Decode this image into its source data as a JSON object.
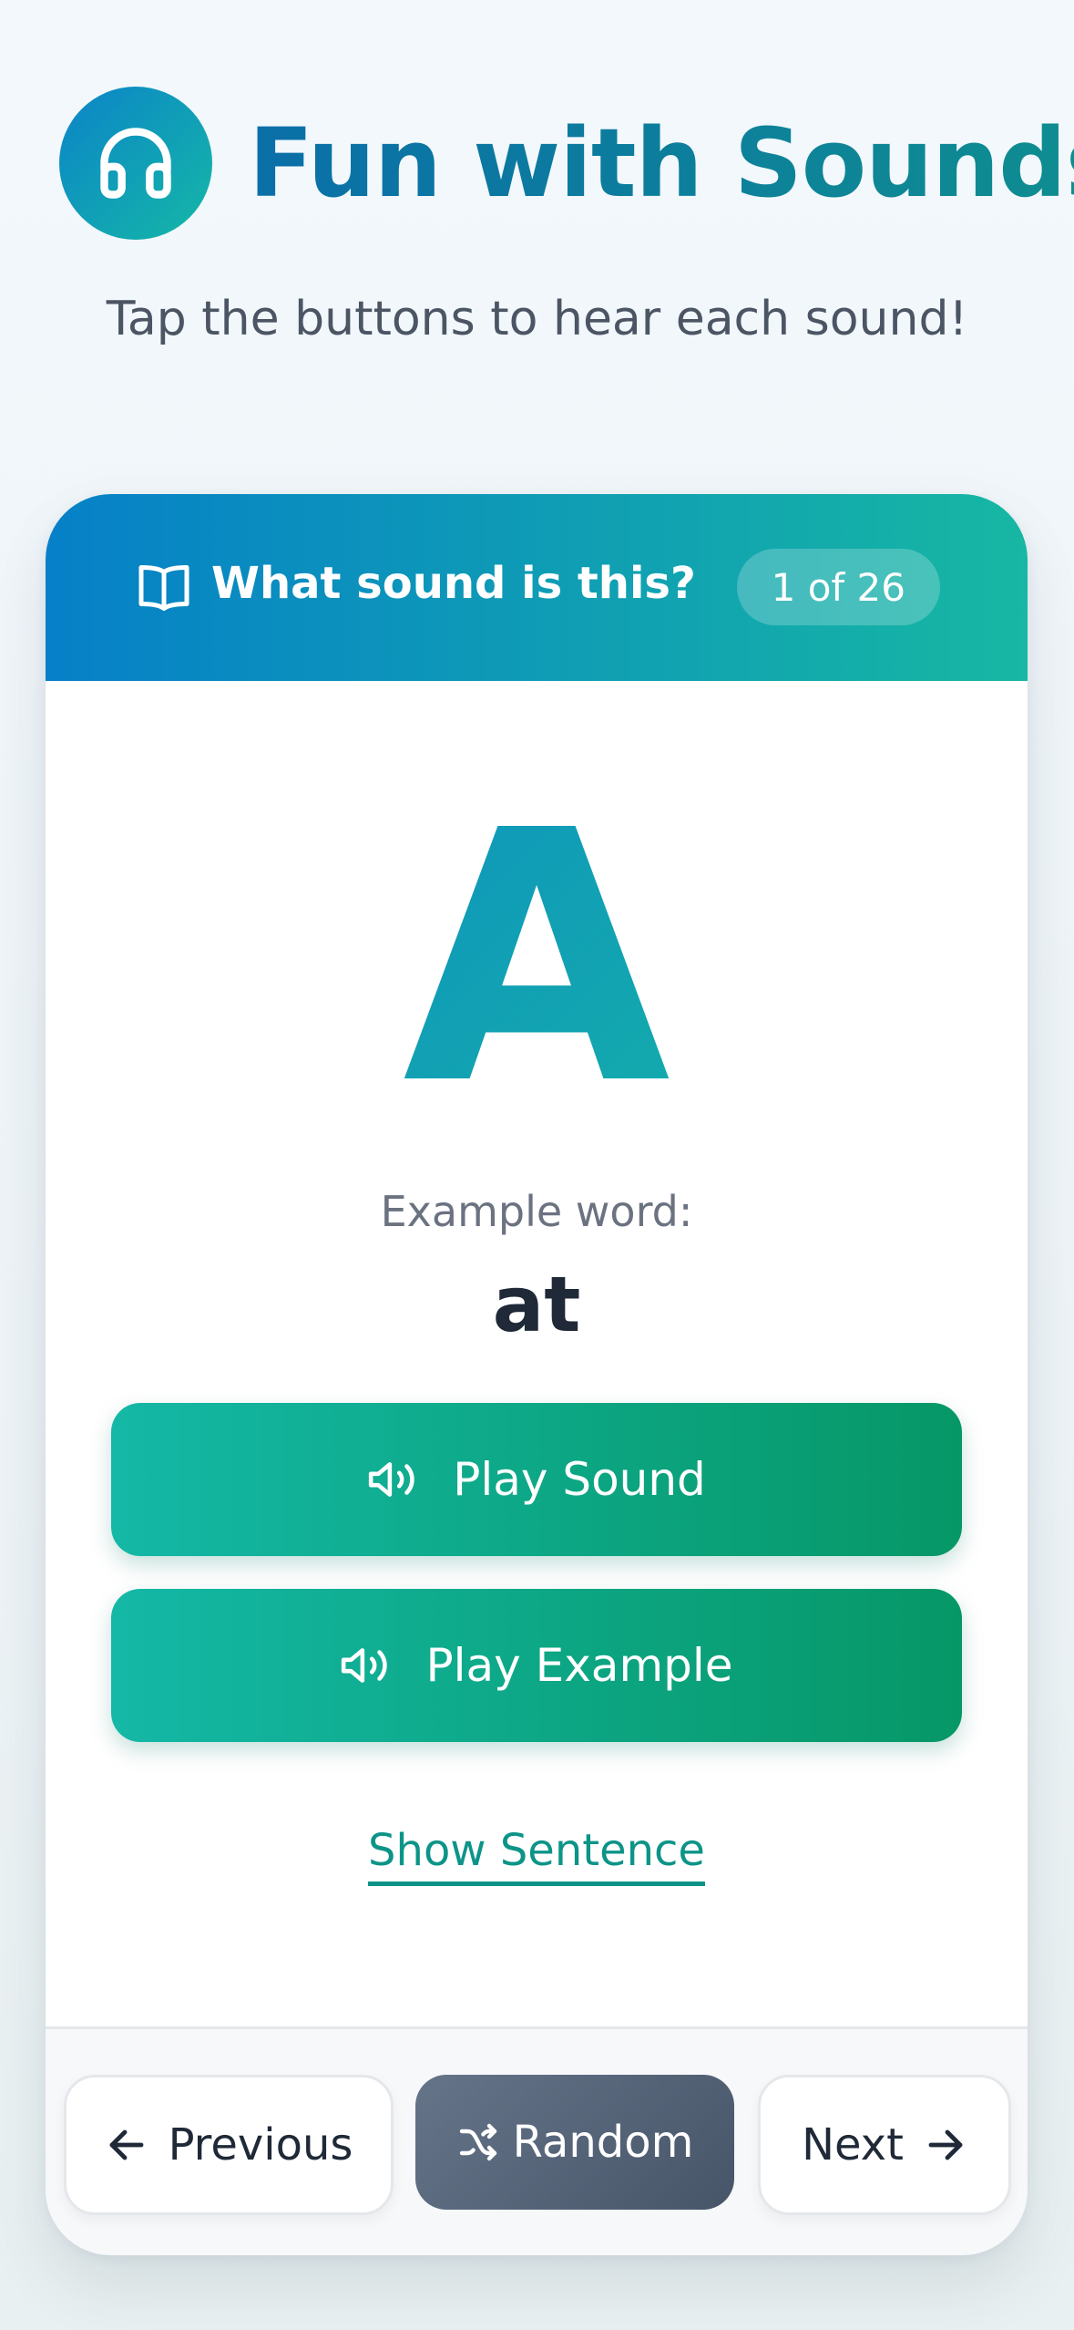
{
  "header": {
    "icon": "headphones-icon",
    "title": "Fun with Sounds",
    "subtitle": "Tap the buttons to hear each sound!"
  },
  "card": {
    "header_icon": "book-icon",
    "header_title": "What sound is this?",
    "counter": "1 of 26",
    "letter": "A",
    "example_label": "Example word:",
    "example_word": "at",
    "play_sound_label": "Play Sound",
    "play_example_label": "Play Example",
    "show_sentence_label": "Show Sentence"
  },
  "nav": {
    "previous_label": "Previous",
    "random_label": "Random",
    "next_label": "Next"
  },
  "colors": {
    "accent_blue": "#0680c8",
    "accent_teal": "#17b7a3",
    "play_green": "#069766",
    "random_slate": "#475569"
  }
}
